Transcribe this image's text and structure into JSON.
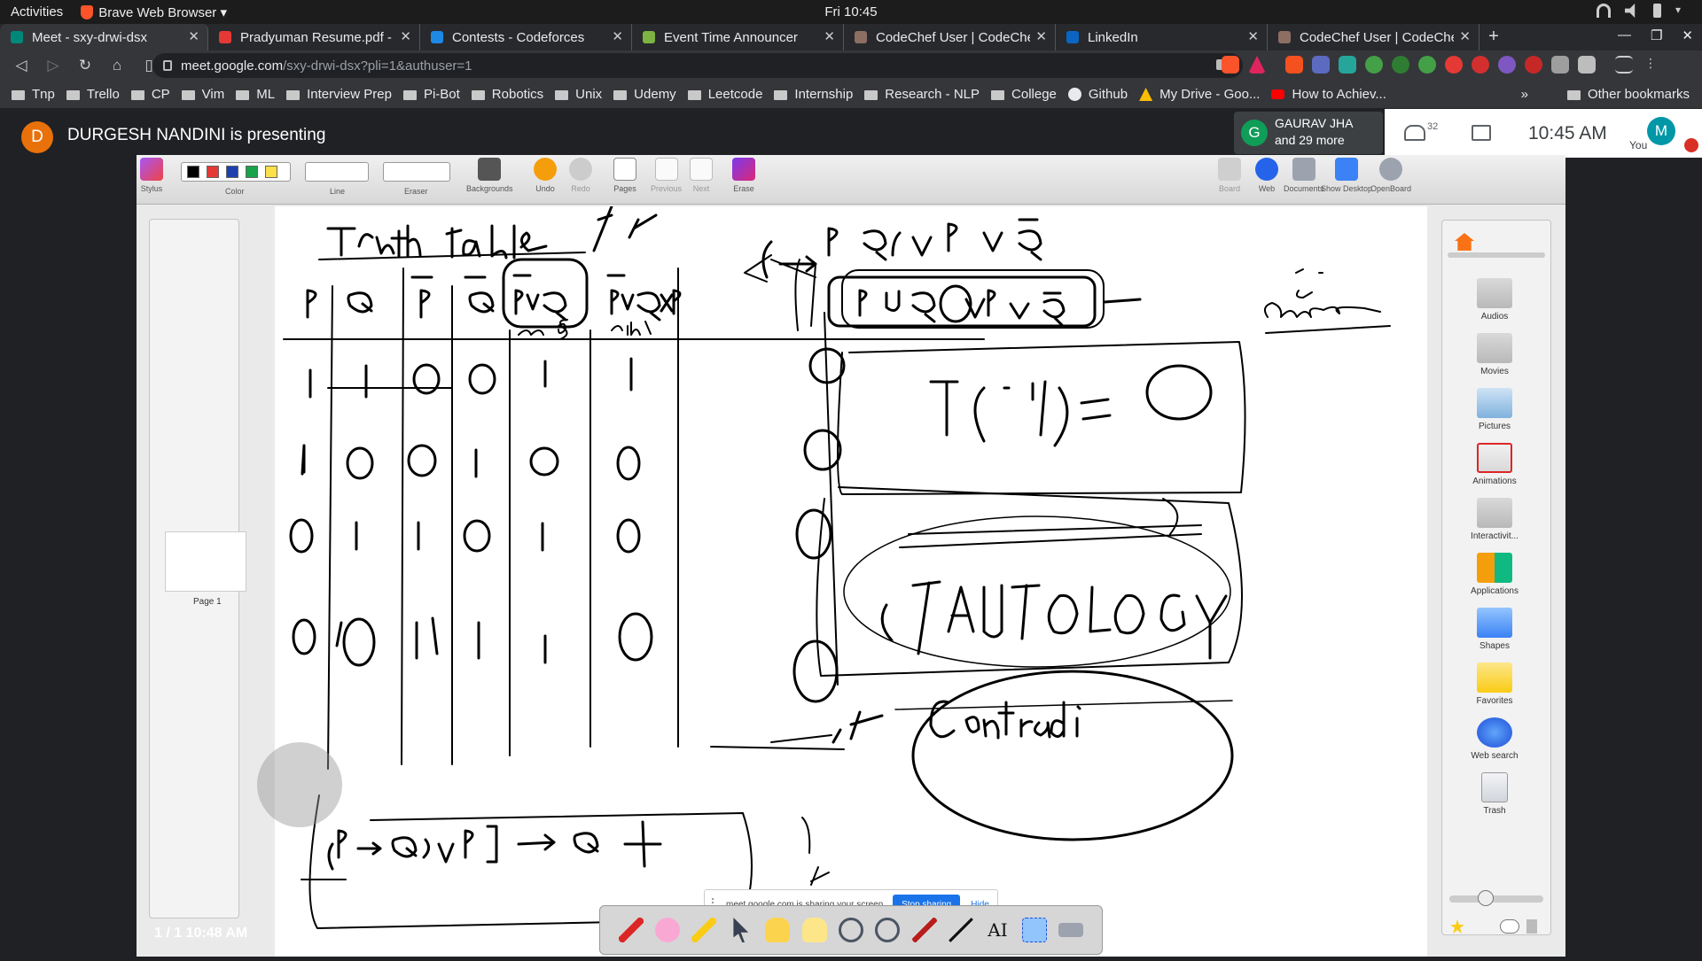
{
  "os": {
    "activities": "Activities",
    "app_name": "Brave Web Browser ▾",
    "clock": "Fri 10:45"
  },
  "tabs": [
    {
      "label": "Meet - sxy-drwi-dsx",
      "favicon_color": "#00897b",
      "active": true
    },
    {
      "label": "Pradyuman Resume.pdf - C",
      "favicon_color": "#e53935",
      "active": false
    },
    {
      "label": "Contests - Codeforces",
      "favicon_color": "#1e88e5",
      "active": false
    },
    {
      "label": "Event Time Announcer",
      "favicon_color": "#7cb342",
      "active": false
    },
    {
      "label": "CodeChef User | CodeChef",
      "favicon_color": "#8d6e63",
      "active": false
    },
    {
      "label": "LinkedIn",
      "favicon_color": "#0a66c2",
      "active": false
    },
    {
      "label": "CodeChef User | CodeChef",
      "favicon_color": "#8d6e63",
      "active": false
    }
  ],
  "newtab": "+",
  "address": {
    "host": "meet.google.com",
    "path": "/sxy-drwi-dsx?pli=1&authuser=1"
  },
  "bookmarks": [
    {
      "label": "Tnp",
      "type": "folder"
    },
    {
      "label": "Trello",
      "type": "folder"
    },
    {
      "label": "CP",
      "type": "folder"
    },
    {
      "label": "Vim",
      "type": "folder"
    },
    {
      "label": "ML",
      "type": "folder"
    },
    {
      "label": "Interview Prep",
      "type": "folder"
    },
    {
      "label": "Pi-Bot",
      "type": "folder"
    },
    {
      "label": "Robotics",
      "type": "folder"
    },
    {
      "label": "Unix",
      "type": "folder"
    },
    {
      "label": "Udemy",
      "type": "folder"
    },
    {
      "label": "Leetcode",
      "type": "folder"
    },
    {
      "label": "Internship",
      "type": "folder"
    },
    {
      "label": "Research - NLP",
      "type": "folder"
    },
    {
      "label": "College",
      "type": "folder"
    },
    {
      "label": "Github",
      "type": "site"
    },
    {
      "label": "My Drive - Goo...",
      "type": "site"
    },
    {
      "label": "How to Achiev...",
      "type": "site"
    }
  ],
  "bookmarks_more": "»",
  "other_bookmarks": "Other bookmarks",
  "meet": {
    "presenter_initial": "D",
    "presenter_text": "DURGESH NANDINI is presenting",
    "participant_initial": "G",
    "participant_name": "GAURAV JHA",
    "participant_more": "and 29 more",
    "people_count": "32",
    "time": "10:45 AM",
    "you_initial": "M",
    "you_label": "You"
  },
  "openboard": {
    "toolbar": [
      "Stylus",
      "Color",
      "Line",
      "Eraser",
      "Backgrounds",
      "Undo",
      "Redo",
      "Pages",
      "Previous",
      "Next",
      "Erase"
    ],
    "toolbar_right": [
      "Board",
      "Web",
      "Documents",
      "Show Desktop",
      "OpenBoard"
    ],
    "colors": [
      "#000000",
      "#e53935",
      "#1e40af",
      "#16a34a",
      "#fde047"
    ],
    "library": [
      "Audios",
      "Movies",
      "Pictures",
      "Animations",
      "Interactivit...",
      "Applications",
      "Shapes",
      "Favorites",
      "Web search",
      "Trash"
    ],
    "thumb_label": "Page 1",
    "page_info": "1 / 1  10:48 AM"
  },
  "share_banner": {
    "text": "meet.google.com is sharing your screen.",
    "stop": "Stop sharing",
    "hide": "Hide"
  }
}
